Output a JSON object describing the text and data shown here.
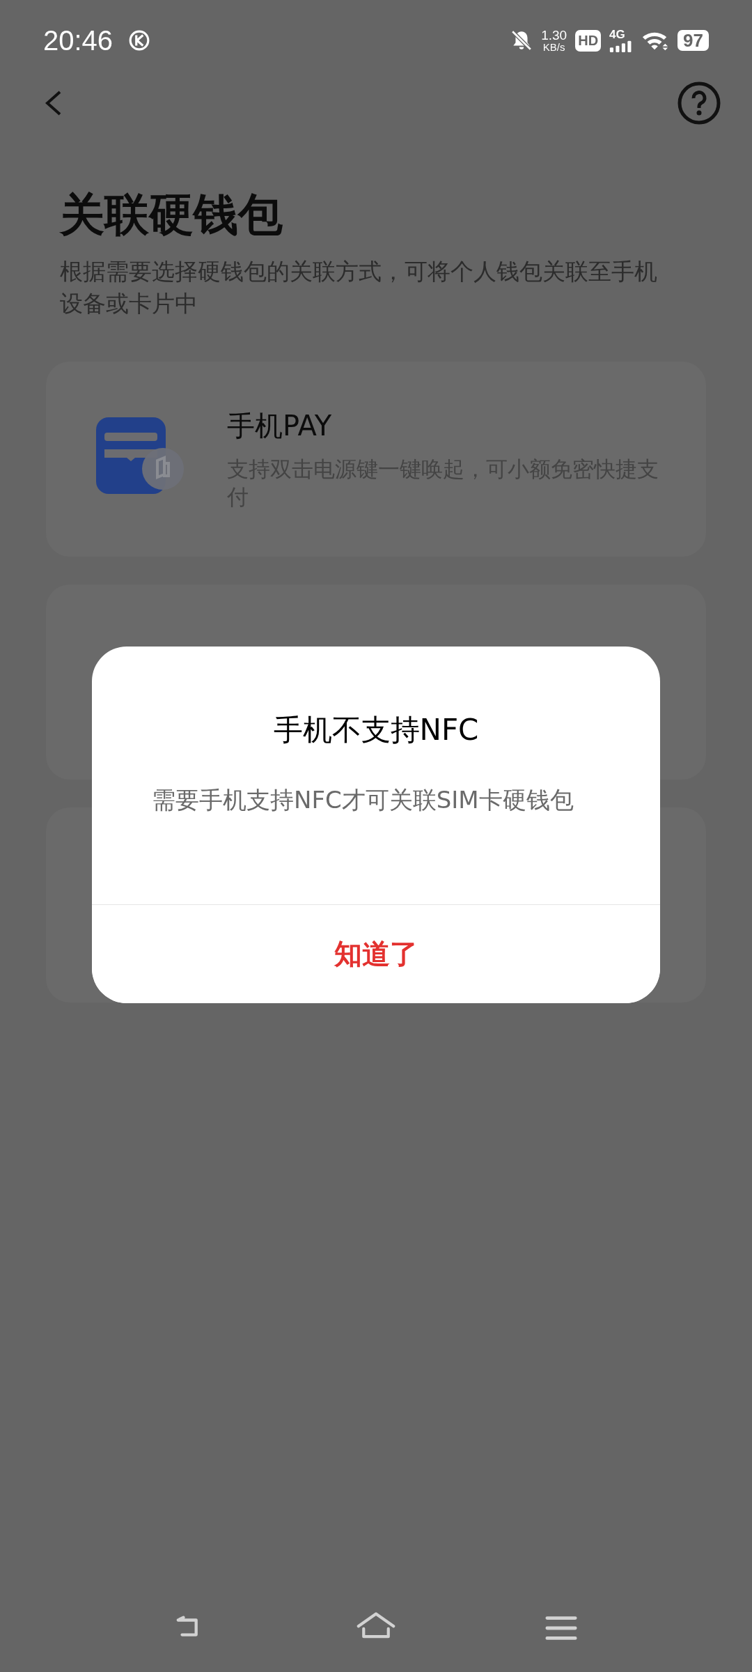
{
  "status_bar": {
    "time": "20:46",
    "speed": "1.30",
    "speed_unit": "KB/s",
    "hd": "HD",
    "network": "4G",
    "battery": "97"
  },
  "title": "关联硬钱包",
  "subtitle": "根据需要选择硬钱包的关联方式，可将个人钱包关联至手机设备或卡片中",
  "options": [
    {
      "kind": "wallet",
      "title": "手机PAY",
      "description": "支持双击电源键一键唤起，可小额免密快捷支付"
    },
    {
      "kind": "covered"
    },
    {
      "kind": "covered"
    }
  ],
  "dialog": {
    "title": "手机不支持NFC",
    "message": "需要手机支持NFC才可关联SIM卡硬钱包",
    "button": "知道了"
  }
}
